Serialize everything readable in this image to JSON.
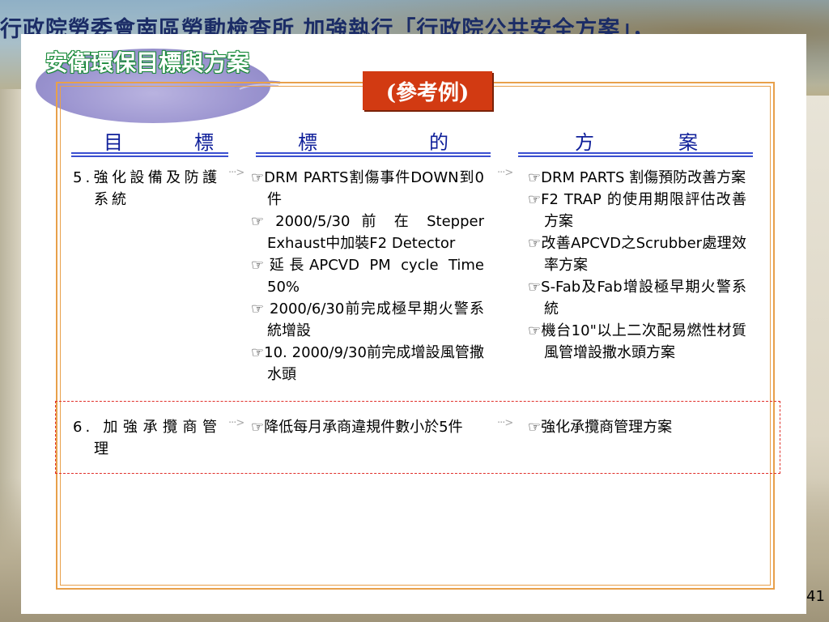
{
  "banner": {
    "text": "行政院勞委會南區勞動檢查所  加強執行「行政院公共安全方案」，"
  },
  "slide": {
    "title": "安衛環保目標與方案",
    "ref_badge": "(參考例)",
    "columns": [
      {
        "label": [
          "目",
          "標"
        ]
      },
      {
        "label": [
          "標",
          "的"
        ]
      },
      {
        "label": [
          "方",
          "案"
        ]
      }
    ],
    "arrow_glyph": "···>",
    "rows": [
      {
        "goal": "5.強化設備及防護系統",
        "targets": [
          "☞DRM PARTS割傷事件DOWN到0件",
          "☞ 2000/5/30 前 在 Stepper Exhaust中加裝F2 Detector",
          "☞延長APCVD PM cycle Time 50%",
          "☞ 2000/6/30前完成極早期火警系統增設",
          "☞10. 2000/9/30前完成增設風管撒水頭"
        ],
        "plans": [
          "☞DRM PARTS 割傷預防改善方案",
          "☞F2 TRAP 的使用期限評估改善方案",
          "☞改善APCVD之Scrubber處理效率方案",
          "☞S-Fab及Fab增設極早期火警系統",
          "☞機台10\"以上二次配易燃性材質風管增設撒水頭方案"
        ]
      },
      {
        "goal": "6. 加強承攬商管理",
        "targets": [
          "☞降低每月承商違規件數小於5件"
        ],
        "plans": [
          "☞強化承攬商管理方案"
        ]
      }
    ],
    "page_number": "41"
  },
  "colors": {
    "frame": "#e8a04a",
    "header_text": "#10209a",
    "badge": "#d23a12",
    "dash": "#e0302a"
  }
}
